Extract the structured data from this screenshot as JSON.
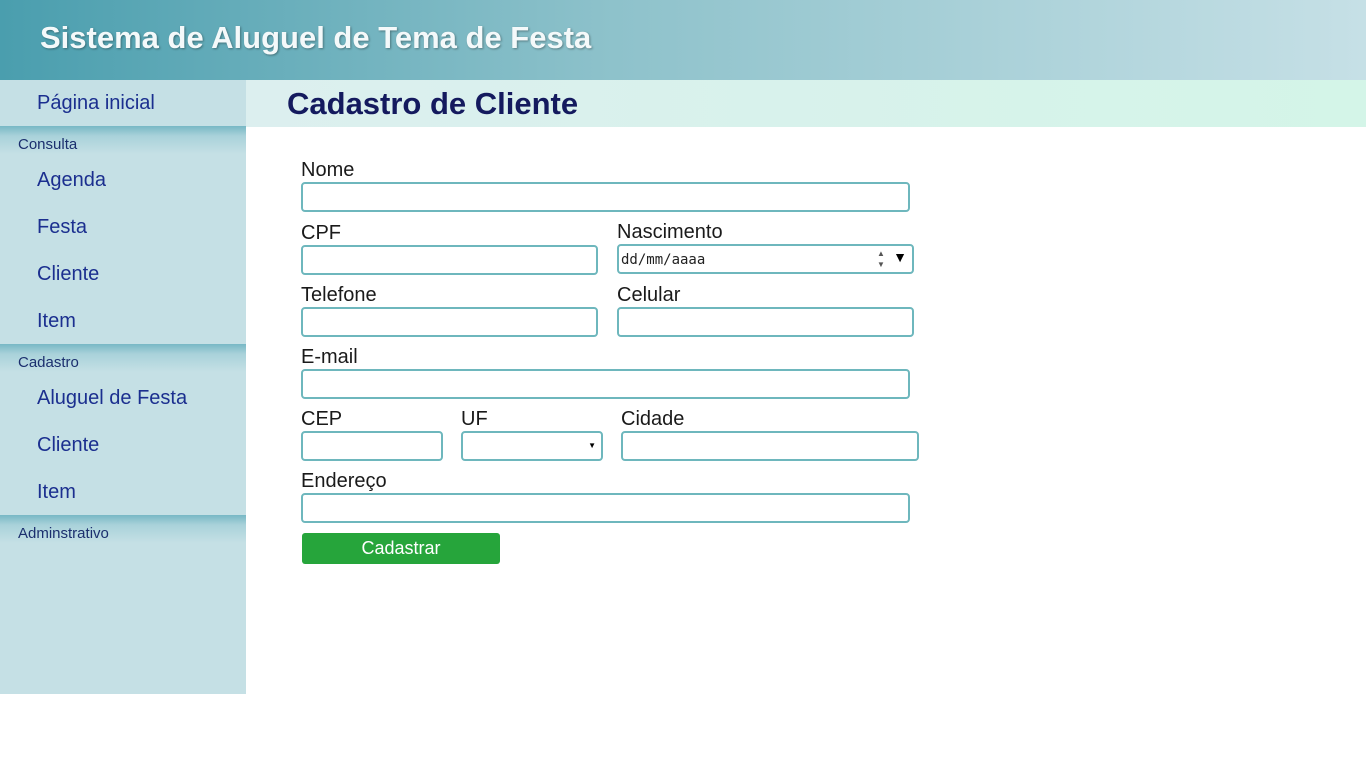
{
  "header": {
    "title": "Sistema de Aluguel de Tema de Festa"
  },
  "sidebar": {
    "home": "Página inicial",
    "consulta": {
      "label": "Consulta",
      "items": [
        "Agenda",
        "Festa",
        "Cliente",
        "Item"
      ]
    },
    "cadastro": {
      "label": "Cadastro",
      "items": [
        "Aluguel de Festa",
        "Cliente",
        "Item"
      ]
    },
    "administrativo": {
      "label": "Adminstrativo"
    }
  },
  "page": {
    "title": "Cadastro de Cliente"
  },
  "form": {
    "nome": {
      "label": "Nome",
      "value": ""
    },
    "cpf": {
      "label": "CPF",
      "value": ""
    },
    "nascimento": {
      "label": "Nascimento",
      "placeholder": "dd/mm/aaaa"
    },
    "telefone": {
      "label": "Telefone",
      "value": ""
    },
    "celular": {
      "label": "Celular",
      "value": ""
    },
    "email": {
      "label": "E-mail",
      "value": ""
    },
    "cep": {
      "label": "CEP",
      "value": ""
    },
    "uf": {
      "label": "UF",
      "selected": ""
    },
    "cidade": {
      "label": "Cidade",
      "value": ""
    },
    "endereco": {
      "label": "Endereço",
      "value": ""
    },
    "submit": "Cadastrar"
  },
  "colors": {
    "accent": "#26a53b",
    "field_border": "#6eb7bd",
    "link": "#1b2f8f",
    "sidebar_bg": "#c5e0e5"
  }
}
